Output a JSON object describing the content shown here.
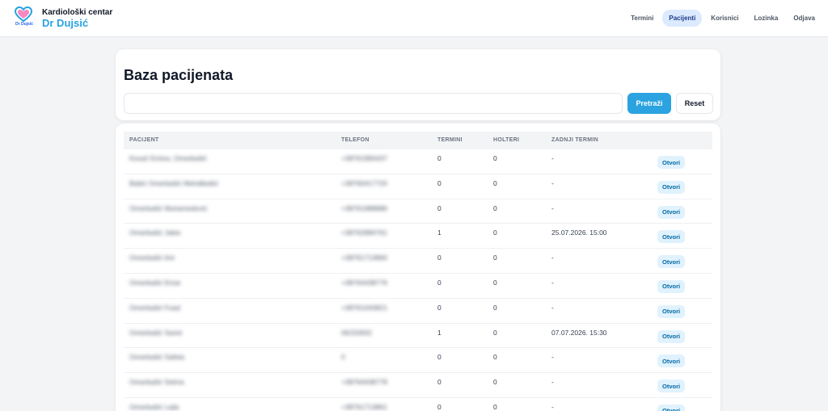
{
  "header": {
    "logo_text": "Dr Dujsić",
    "brand_line1": "Kardiološki centar",
    "brand_line2": "Dr Dujsić",
    "nav": [
      {
        "label": "Termini",
        "active": false
      },
      {
        "label": "Pacijenti",
        "active": true
      },
      {
        "label": "Korisnici",
        "active": false
      },
      {
        "label": "Lozinka",
        "active": false
      },
      {
        "label": "Odjava",
        "active": false
      }
    ]
  },
  "search": {
    "title": "Baza pacijenata",
    "value": "",
    "placeholder": "",
    "search_label": "Pretraži",
    "reset_label": "Reset"
  },
  "table": {
    "columns": [
      "PACIJENT",
      "TELEFON",
      "TERMINI",
      "HOLTERI",
      "ZADNJI TERMIN"
    ],
    "open_label": "Otvori",
    "rows": [
      {
        "patient": "Kovač Emina, Omerbašić",
        "phone": "+38761960437",
        "termini": "0",
        "holteri": "0",
        "last": "-"
      },
      {
        "patient": "Babić Omerbašić Mehdibašić",
        "phone": "+38760417720",
        "termini": "0",
        "holteri": "0",
        "last": "-"
      },
      {
        "patient": "Omerbašić Muhamedović",
        "phone": "+38761988886",
        "termini": "0",
        "holteri": "0",
        "last": "-"
      },
      {
        "patient": "Omerbašić Jakie",
        "phone": "+38762884761",
        "termini": "1",
        "holteri": "0",
        "last": "25.07.2026. 15:00"
      },
      {
        "patient": "Omerbašić Ant",
        "phone": "+38761713860",
        "termini": "0",
        "holteri": "0",
        "last": "-"
      },
      {
        "patient": "Omerbašić Emar",
        "phone": "+38764438776",
        "termini": "0",
        "holteri": "0",
        "last": "-"
      },
      {
        "patient": "Omerbašić Fuad",
        "phone": "+38761043821",
        "termini": "0",
        "holteri": "0",
        "last": "-"
      },
      {
        "patient": "Omerbašić Samir",
        "phone": "06232832",
        "termini": "1",
        "holteri": "0",
        "last": "07.07.2026. 15:30"
      },
      {
        "patient": "Omerbašić Safeta",
        "phone": "0",
        "termini": "0",
        "holteri": "0",
        "last": "-"
      },
      {
        "patient": "Omerbašić Selma",
        "phone": "+38764438778",
        "termini": "0",
        "holteri": "0",
        "last": "-"
      },
      {
        "patient": "Omerbašić Lejla",
        "phone": "+38761713861",
        "termini": "0",
        "holteri": "0",
        "last": "-"
      }
    ]
  },
  "colors": {
    "accent": "#2aa3e0",
    "nav_active_bg": "#dbeafe",
    "open_button_bg": "#e0f2fe",
    "page_bg": "#f3f4f6"
  }
}
